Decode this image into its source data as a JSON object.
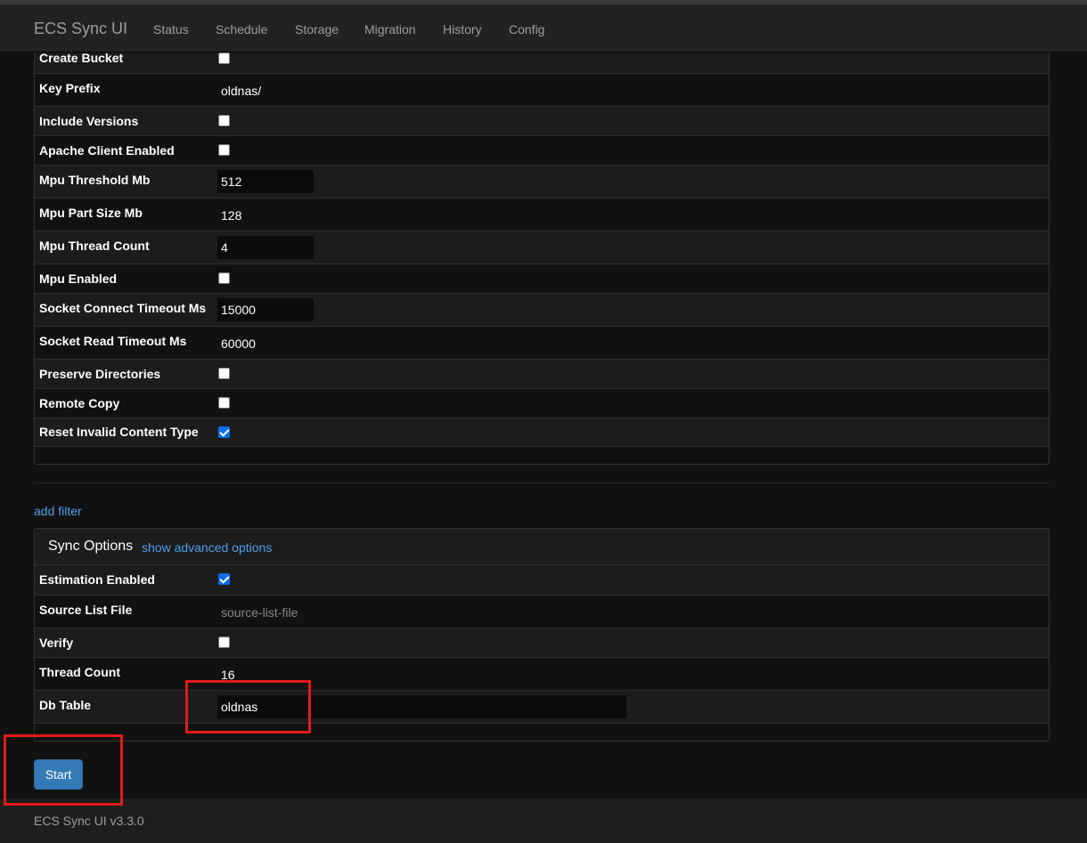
{
  "navbar": {
    "brand": "ECS Sync UI",
    "items": [
      "Status",
      "Schedule",
      "Storage",
      "Migration",
      "History",
      "Config"
    ]
  },
  "storage_options": {
    "rows": [
      {
        "label": "Create Bucket",
        "type": "checkbox",
        "checked": false
      },
      {
        "label": "Key Prefix",
        "type": "text",
        "value": "oldnas/"
      },
      {
        "label": "Include Versions",
        "type": "checkbox",
        "checked": false
      },
      {
        "label": "Apache Client Enabled",
        "type": "checkbox",
        "checked": false
      },
      {
        "label": "Mpu Threshold Mb",
        "type": "input",
        "value": "512"
      },
      {
        "label": "Mpu Part Size Mb",
        "type": "text",
        "value": "128"
      },
      {
        "label": "Mpu Thread Count",
        "type": "input",
        "value": "4"
      },
      {
        "label": "Mpu Enabled",
        "type": "checkbox",
        "checked": false
      },
      {
        "label": "Socket Connect Timeout Ms",
        "type": "input",
        "value": "15000"
      },
      {
        "label": "Socket Read Timeout Ms",
        "type": "text",
        "value": "60000"
      },
      {
        "label": "Preserve Directories",
        "type": "checkbox",
        "checked": false
      },
      {
        "label": "Remote Copy",
        "type": "checkbox",
        "checked": false
      },
      {
        "label": "Reset Invalid Content Type",
        "type": "checkbox",
        "checked": true
      }
    ]
  },
  "add_filter": "add filter",
  "sync_options": {
    "title": "Sync Options",
    "advanced_link": "show advanced options",
    "rows": [
      {
        "label": "Estimation Enabled",
        "type": "checkbox",
        "checked": true
      },
      {
        "label": "Source List File",
        "type": "placeholder",
        "placeholder": "source-list-file"
      },
      {
        "label": "Verify",
        "type": "checkbox",
        "checked": false
      },
      {
        "label": "Thread Count",
        "type": "text",
        "value": "16"
      },
      {
        "label": "Db Table",
        "type": "input",
        "value": "oldnas"
      }
    ]
  },
  "start_button": "Start",
  "footer": "ECS Sync UI v3.3.0",
  "colors": {
    "accent": "#337ab7",
    "link": "#4e9eed",
    "annotation": "#e01b1b",
    "checkbox_checked": "#0b6ee8"
  }
}
